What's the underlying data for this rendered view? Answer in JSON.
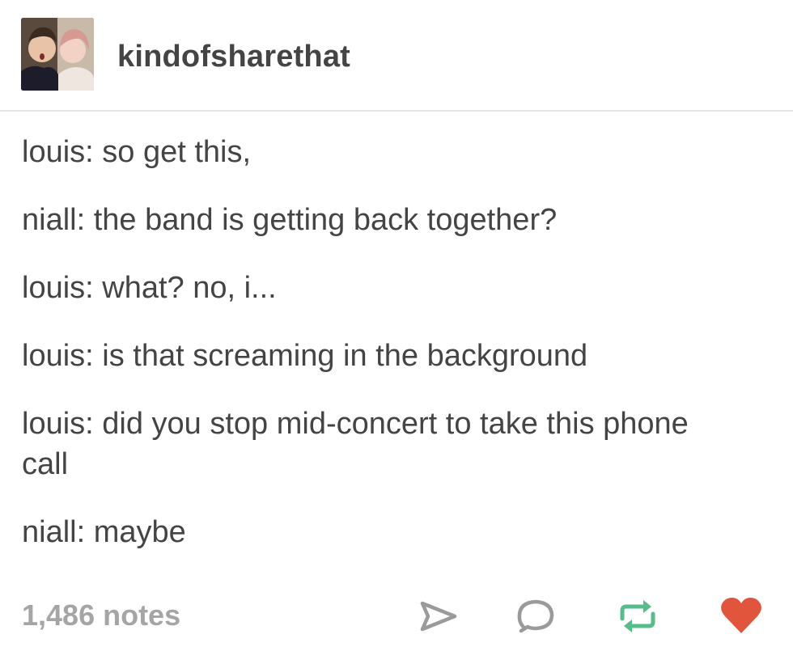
{
  "post": {
    "blog_name": "kindofsharethat",
    "lines": [
      "louis: so get this,",
      "niall: the band is getting back together?",
      "louis: what? no, i...",
      "louis: is that screaming in the background",
      "louis: did you stop mid-concert to take this phone call",
      "niall: maybe"
    ],
    "notes": "1,486 notes"
  },
  "icons": {
    "share": "share-arrow-icon",
    "reply": "reply-bubble-icon",
    "reblog": "reblog-icon",
    "like": "heart-icon"
  },
  "colors": {
    "text": "#444444",
    "notes": "#a5a5a5",
    "reblog": "#56bc8a",
    "like": "#e0553b"
  }
}
